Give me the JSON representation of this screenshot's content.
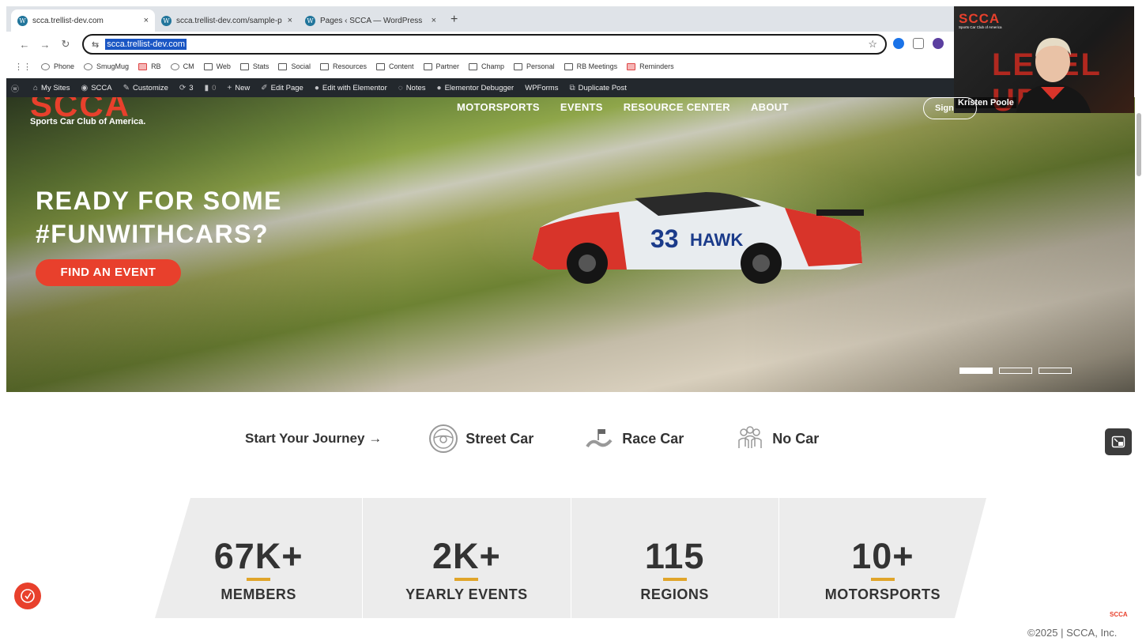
{
  "browser": {
    "tabs": [
      {
        "label": "scca.trellist-dev.com",
        "active": true
      },
      {
        "label": "scca.trellist-dev.com/sample-p",
        "active": false
      },
      {
        "label": "Pages ‹ SCCA — WordPress",
        "active": false
      }
    ],
    "close_glyph": "×",
    "new_tab_glyph": "+",
    "url": "scca.trellist-dev.com",
    "bookmarks": [
      "Phone",
      "SmugMug",
      "RB",
      "CM",
      "Web",
      "Stats",
      "Social",
      "Resources",
      "Content",
      "Partner",
      "Champ",
      "Personal",
      "RB Meetings",
      "Reminders"
    ]
  },
  "wp_admin_bar": {
    "my_sites": "My Sites",
    "site": "SCCA",
    "customize": "Customize",
    "updates": "3",
    "comments": "0",
    "new": "New",
    "edit_page": "Edit Page",
    "elementor": "Edit with Elementor",
    "notes": "Notes",
    "debugger": "Elementor Debugger",
    "wpforms": "WPForms",
    "duplicate": "Duplicate Post"
  },
  "site": {
    "logo": "SCCA",
    "logo_sub": "Sports Car Club of America.",
    "nav": [
      "MOTORSPORTS",
      "EVENTS",
      "RESOURCE CENTER",
      "ABOUT"
    ],
    "sign_in": "Sign"
  },
  "hero": {
    "title_line1": "READY FOR SOME",
    "title_line2": "#FUNWITHCARS?",
    "cta": "FIND AN EVENT",
    "car_number": "33",
    "car_text": "HAWK"
  },
  "journey": {
    "lead": "Start Your Journey →",
    "options": [
      "Street Car",
      "Race Car",
      "No Car"
    ]
  },
  "stats": [
    {
      "value": "67K+",
      "label": "MEMBERS"
    },
    {
      "value": "2K+",
      "label": "YEARLY EVENTS"
    },
    {
      "value": "115",
      "label": "REGIONS"
    },
    {
      "value": "10+",
      "label": "MOTORSPORTS"
    }
  ],
  "footer": {
    "logo": "SCCA",
    "copyright": "©2025 | SCCA, Inc."
  },
  "webcam": {
    "brand": "SCCA",
    "brand_sub": "Sports Car Club of America",
    "backdrop_text": "LEVEL UP",
    "name": "Kristen Poole"
  },
  "colors": {
    "brand_red": "#e8402c",
    "accent_gold": "#e0a52a",
    "wp_bar": "#23282d"
  }
}
